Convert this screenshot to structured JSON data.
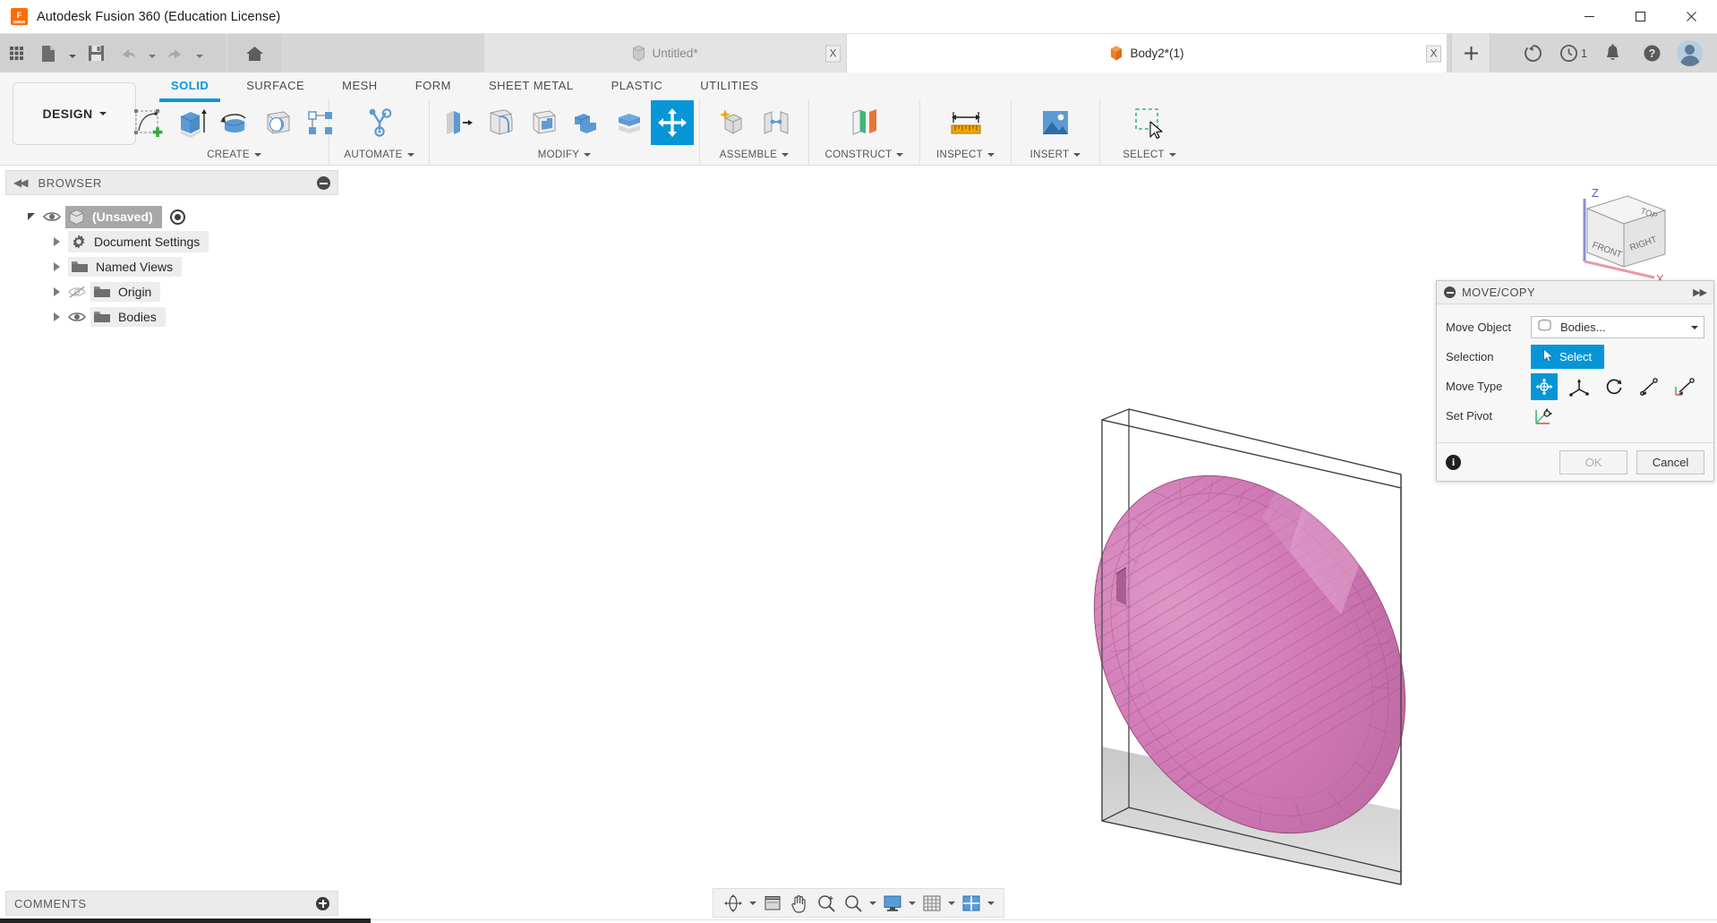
{
  "window": {
    "title": "Autodesk Fusion 360 (Education License)",
    "app_icon": "fusion-logo-icon",
    "minimize_label": "—",
    "maximize_label": "□",
    "close_label": "✕"
  },
  "quick_access": {
    "grid_label": "app-grid-icon",
    "new_label": "new-document-icon",
    "save_label": "save-icon",
    "undo_label": "undo-icon",
    "redo_label": "redo-icon",
    "home_label": "home-icon"
  },
  "tabs": [
    {
      "label": "Untitled*",
      "icon": "document-icon",
      "active": false,
      "close": "X"
    },
    {
      "label": "Body2*(1)",
      "icon": "body-icon",
      "active": true,
      "close": "X"
    }
  ],
  "tab_add_label": "+",
  "account": {
    "share_icon": "share-icon",
    "recent_icon": "clock-icon",
    "recent_count": "1",
    "notifications_icon": "bell-icon",
    "help_icon": "help-icon",
    "avatar_icon": "user-avatar"
  },
  "ribbon": {
    "workspace_button": "DESIGN",
    "tabs": [
      {
        "label": "SOLID",
        "active": true
      },
      {
        "label": "SURFACE",
        "active": false
      },
      {
        "label": "MESH",
        "active": false
      },
      {
        "label": "FORM",
        "active": false
      },
      {
        "label": "SHEET METAL",
        "active": false
      },
      {
        "label": "PLASTIC",
        "active": false
      },
      {
        "label": "UTILITIES",
        "active": false
      }
    ],
    "panels": [
      {
        "label": "CREATE",
        "has_dropdown": true,
        "tools": [
          {
            "name": "create-sketch-icon",
            "selected": false
          },
          {
            "name": "extrude-icon",
            "selected": false
          },
          {
            "name": "revolve-icon",
            "selected": false
          },
          {
            "name": "sphere-icon",
            "selected": false
          },
          {
            "name": "pattern-icon",
            "selected": false
          }
        ]
      },
      {
        "label": "AUTOMATE",
        "has_dropdown": true,
        "tools": [
          {
            "name": "automated-modeling-icon",
            "selected": false
          }
        ]
      },
      {
        "label": "MODIFY",
        "has_dropdown": true,
        "tools": [
          {
            "name": "press-pull-icon",
            "selected": false
          },
          {
            "name": "fillet-icon",
            "selected": false
          },
          {
            "name": "shell-icon",
            "selected": false
          },
          {
            "name": "combine-icon",
            "selected": false
          },
          {
            "name": "offset-face-icon",
            "selected": false
          },
          {
            "name": "move-copy-icon",
            "selected": true
          }
        ]
      },
      {
        "label": "ASSEMBLE",
        "has_dropdown": true,
        "tools": [
          {
            "name": "new-component-icon",
            "selected": false
          },
          {
            "name": "joint-icon",
            "selected": false
          }
        ]
      },
      {
        "label": "CONSTRUCT",
        "has_dropdown": true,
        "tools": [
          {
            "name": "offset-plane-icon",
            "selected": false
          }
        ]
      },
      {
        "label": "INSPECT",
        "has_dropdown": true,
        "tools": [
          {
            "name": "measure-icon",
            "selected": false
          }
        ]
      },
      {
        "label": "INSERT",
        "has_dropdown": true,
        "tools": [
          {
            "name": "insert-canvas-icon",
            "selected": false
          }
        ]
      },
      {
        "label": "SELECT",
        "has_dropdown": true,
        "tools": [
          {
            "name": "window-selection-icon",
            "selected": false
          }
        ]
      }
    ]
  },
  "browser": {
    "header_label": "BROWSER",
    "collapse_icon": "collapse-left-icon",
    "minimize_icon": "minus-circle-icon",
    "tree": [
      {
        "label": "(Unsaved)",
        "icon": "document-icon",
        "expanded": true,
        "visible": true,
        "selected": true,
        "has_radio": true,
        "indent": 0
      },
      {
        "label": "Document Settings",
        "icon": "gear-icon",
        "expanded": false,
        "visible": null,
        "selected": false,
        "has_radio": false,
        "indent": 1
      },
      {
        "label": "Named Views",
        "icon": "folder-icon",
        "expanded": false,
        "visible": null,
        "selected": false,
        "has_radio": false,
        "indent": 1
      },
      {
        "label": "Origin",
        "icon": "folder-icon",
        "expanded": false,
        "visible": false,
        "selected": false,
        "has_radio": false,
        "indent": 1
      },
      {
        "label": "Bodies",
        "icon": "folder-icon",
        "expanded": false,
        "visible": true,
        "selected": false,
        "has_radio": false,
        "indent": 1
      }
    ]
  },
  "viewcube": {
    "face_top": "TOP",
    "face_front": "FRONT",
    "face_right": "RIGHT",
    "axis_z": "Z",
    "axis_x": "X",
    "axis_z_color": "#6f6fe0",
    "axis_x_color": "#e07a8a"
  },
  "model": {
    "body_color": "#d27ab8",
    "body_edge_color": "#8a4f77",
    "bounding_box_color": "#4a4a4a",
    "shadow_color": "#d5d5d5",
    "description": "mesh ellipsoid body inside a bounding box"
  },
  "dialog": {
    "title": "MOVE/COPY",
    "collapse_icon": "minus-circle-icon",
    "expand_icon": "double-chevron-right-icon",
    "rows": {
      "move_object_label": "Move Object",
      "move_object_value": "Bodies...",
      "move_object_icon": "bodies-icon",
      "selection_label": "Selection",
      "selection_button": "Select",
      "selection_icon": "cursor-arrow-icon",
      "move_type_label": "Move Type",
      "set_pivot_label": "Set Pivot"
    },
    "move_types": [
      {
        "name": "free-move-icon",
        "selected": true
      },
      {
        "name": "translate-xyz-icon",
        "selected": false
      },
      {
        "name": "rotate-icon",
        "selected": false
      },
      {
        "name": "point-to-point-icon",
        "selected": false
      },
      {
        "name": "point-to-position-icon",
        "selected": false
      }
    ],
    "set_pivot_icon": "set-pivot-icon",
    "info_icon": "info-icon",
    "ok_label": "OK",
    "ok_enabled": false,
    "cancel_label": "Cancel",
    "accent_color": "#0696d7"
  },
  "comments": {
    "label": "COMMENTS",
    "add_icon": "plus-circle-icon"
  },
  "navbar": [
    {
      "name": "orbit-icon",
      "has_caret": true
    },
    {
      "name": "look-at-icon",
      "has_caret": false
    },
    {
      "name": "pan-icon",
      "has_caret": false
    },
    {
      "name": "zoom-in-icon",
      "has_caret": false
    },
    {
      "name": "zoom-icon",
      "has_caret": true
    },
    {
      "name": "display-settings-icon",
      "has_caret": true
    },
    {
      "name": "grid-snaps-icon",
      "has_caret": true
    },
    {
      "name": "viewports-icon",
      "has_caret": true
    }
  ]
}
